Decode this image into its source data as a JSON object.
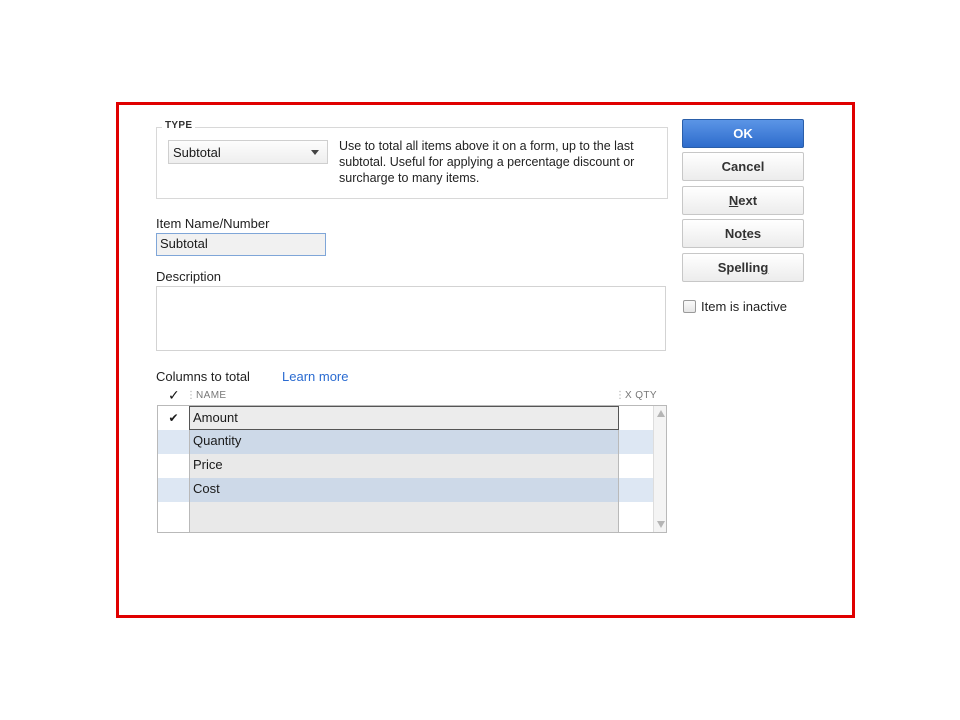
{
  "type_section": {
    "legend": "TYPE",
    "selected": "Subtotal",
    "description": "Use to total all items above it on a form, up to the last subtotal. Useful for applying a percentage discount or surcharge to many items."
  },
  "item_name": {
    "label": "Item Name/Number",
    "value": "Subtotal"
  },
  "description": {
    "label": "Description",
    "value": ""
  },
  "columns": {
    "label": "Columns to total",
    "learn_more": "Learn more",
    "header_check": "✓",
    "header_name": "NAME",
    "header_qty": "X QTY",
    "rows": [
      {
        "checked": "✔",
        "name": "Amount"
      },
      {
        "checked": "",
        "name": "Quantity"
      },
      {
        "checked": "",
        "name": "Price"
      },
      {
        "checked": "",
        "name": "Cost"
      },
      {
        "checked": "",
        "name": ""
      }
    ]
  },
  "buttons": {
    "ok": "OK",
    "cancel": "Cancel",
    "next_pre": "",
    "next_u": "N",
    "next_post": "ext",
    "notes_pre": "No",
    "notes_u": "t",
    "notes_post": "es",
    "spelling_pre": "Spellin",
    "spelling_u": "g",
    "spelling_post": ""
  },
  "inactive": {
    "label": "Item is inactive",
    "checked": false
  },
  "colors": {
    "frame": "#e00000",
    "primary": "#2e6ccc",
    "link": "#2a6bd1"
  }
}
